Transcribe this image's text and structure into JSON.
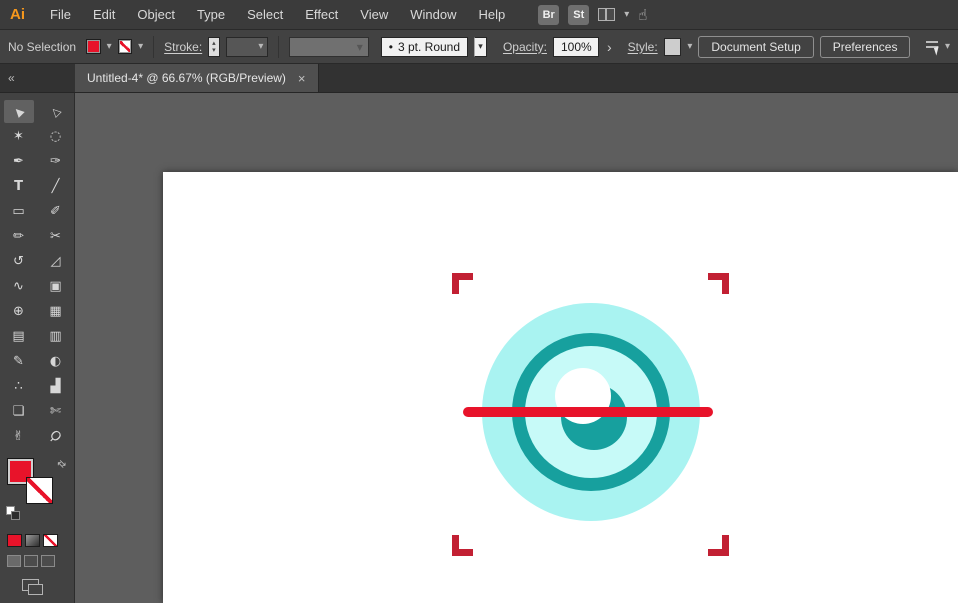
{
  "menubar": {
    "logo": "Ai",
    "items": [
      "File",
      "Edit",
      "Object",
      "Type",
      "Select",
      "Effect",
      "View",
      "Window",
      "Help"
    ],
    "bridge": "Br",
    "stock": "St"
  },
  "control_bar": {
    "selection_status": "No Selection",
    "stroke_label": "Stroke:",
    "brush_bullet": "•",
    "brush_preset": "3 pt. Round",
    "opacity_label": "Opacity:",
    "opacity_value": "100%",
    "style_label": "Style:",
    "document_setup": "Document Setup",
    "preferences": "Preferences"
  },
  "tabbar": {
    "tab_title": "Untitled-4* @ 66.67% (RGB/Preview)"
  },
  "ui": {
    "chevron_down": "▾",
    "chevron_up": "▴",
    "flyout_right": "›",
    "close": "×",
    "collapse": "«",
    "swap": "⇄"
  },
  "tools": [
    {
      "name": "selection",
      "glyph": "▲"
    },
    {
      "name": "direct-selection",
      "glyph": "△"
    },
    {
      "name": "magic-wand",
      "glyph": "✶"
    },
    {
      "name": "lasso",
      "glyph": "◌"
    },
    {
      "name": "pen",
      "glyph": "✒"
    },
    {
      "name": "curvature",
      "glyph": "✑"
    },
    {
      "name": "type",
      "glyph": "T"
    },
    {
      "name": "line-segment",
      "glyph": "╱"
    },
    {
      "name": "rectangle",
      "glyph": "▭"
    },
    {
      "name": "paintbrush",
      "glyph": "✐"
    },
    {
      "name": "pencil",
      "glyph": "✏"
    },
    {
      "name": "scissors",
      "glyph": "✂"
    },
    {
      "name": "rotate",
      "glyph": "↺"
    },
    {
      "name": "scale",
      "glyph": "◿"
    },
    {
      "name": "width",
      "glyph": "∿"
    },
    {
      "name": "free-transform",
      "glyph": "▣"
    },
    {
      "name": "shape-builder",
      "glyph": "⊕"
    },
    {
      "name": "perspective-grid",
      "glyph": "▦"
    },
    {
      "name": "mesh",
      "glyph": "▤"
    },
    {
      "name": "gradient",
      "glyph": "▥"
    },
    {
      "name": "eyedropper",
      "glyph": "✎"
    },
    {
      "name": "blend",
      "glyph": "◐"
    },
    {
      "name": "symbol-sprayer",
      "glyph": "∴"
    },
    {
      "name": "column-graph",
      "glyph": "▟"
    },
    {
      "name": "artboard",
      "glyph": "❏"
    },
    {
      "name": "slice",
      "glyph": "✄"
    },
    {
      "name": "hand",
      "glyph": "✌"
    },
    {
      "name": "zoom",
      "glyph": "Ϙ"
    }
  ],
  "colors": {
    "bar_bg": "#3b3b3b",
    "panel_bg": "#424242",
    "tabbar_bg": "#323232",
    "tab_bg": "#4f4f4f",
    "canvas_bg": "#5e5e5e",
    "logo_orange": "#f5971d",
    "accent_red": "#e8132a",
    "crop_red": "#c22033",
    "eye_outer": "#a9f3f1",
    "eye_inner": "#c7faf8",
    "eye_ring": "#17a09e"
  },
  "artwork": {
    "shapes": [
      "eye-outer-circle",
      "eye-ring",
      "eye-pupil",
      "eye-highlight",
      "scan-line",
      "crop-marks"
    ]
  }
}
